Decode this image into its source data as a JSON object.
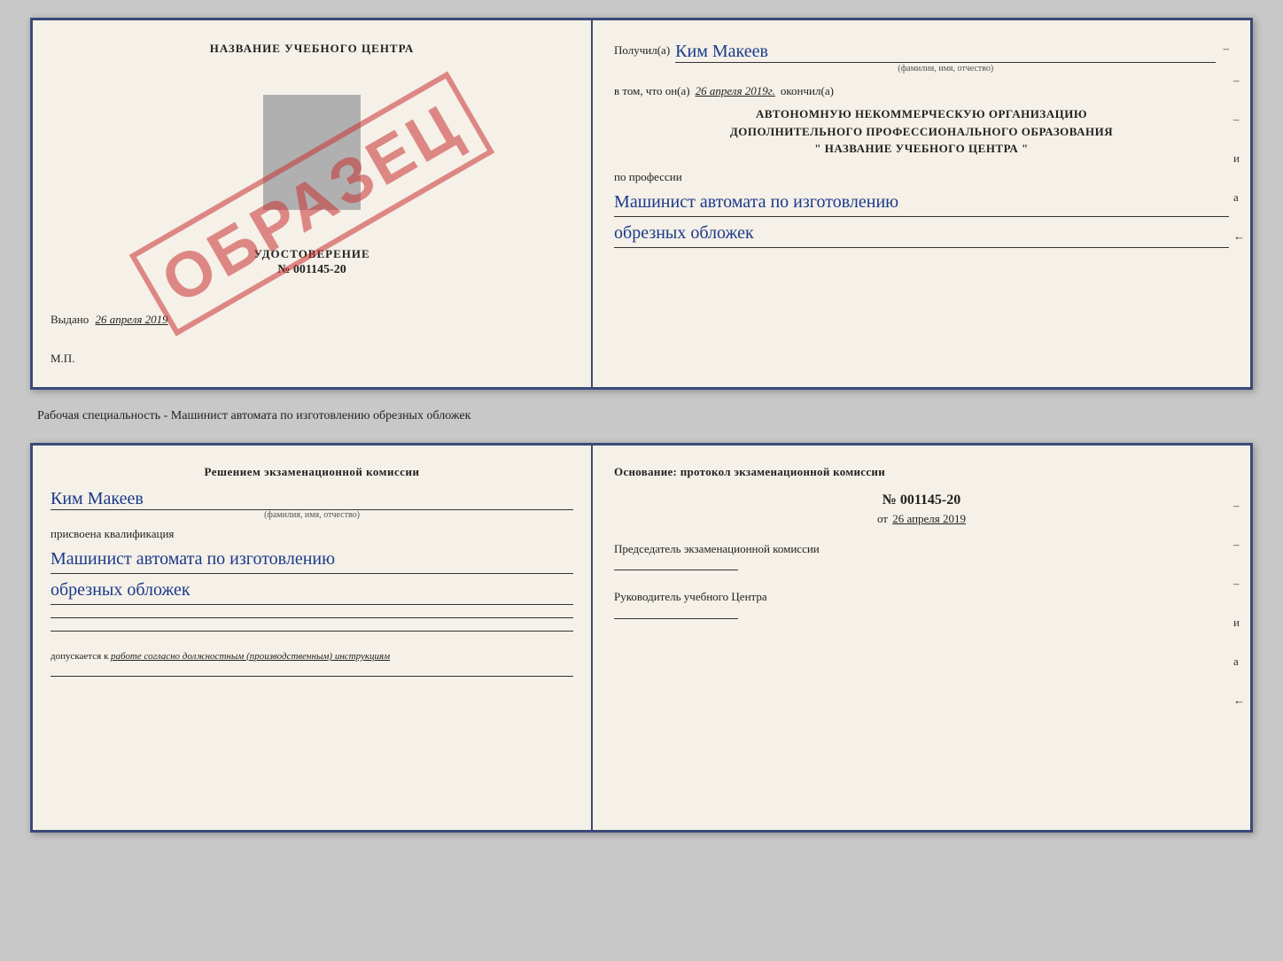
{
  "top_card": {
    "left": {
      "school_name": "НАЗВАНИЕ УЧЕБНОГО ЦЕНТРА",
      "udost_label": "УДОСТОВЕРЕНИЕ",
      "udost_number": "№ 001145-20",
      "vydano_label": "Выдано",
      "vydano_date": "26 апреля 2019",
      "mp_label": "М.П.",
      "obrazec": "ОБРАЗЕЦ"
    },
    "right": {
      "poluchil_label": "Получил(а)",
      "recipient_name": "Ким Макеев",
      "fio_hint": "(фамилия, имя, отчество)",
      "vtom_label": "в том, что он(а)",
      "vtom_date": "26 апреля 2019г.",
      "okonchil_label": "окончил(а)",
      "org_line1": "АВТОНОМНУЮ НЕКОММЕРЧЕСКУЮ ОРГАНИЗАЦИЮ",
      "org_line2": "ДОПОЛНИТЕЛЬНОГО ПРОФЕССИОНАЛЬНОГО ОБРАЗОВАНИЯ",
      "org_line3": "\" НАЗВАНИЕ УЧЕБНОГО ЦЕНТРА \"",
      "po_professii": "по профессии",
      "profession_line1": "Машинист автомата по изготовлению",
      "profession_line2": "обрезных обложек",
      "dash1": "–",
      "dash2": "–",
      "dash3": "–",
      "и_label": "и",
      "а_label": "а",
      "arrow_label": "←"
    }
  },
  "middle_text": "Рабочая специальность - Машинист автомата по изготовлению обрезных обложек",
  "bottom_card": {
    "left": {
      "resheniem_label": "Решением экзаменационной комиссии",
      "recipient_name": "Ким Макеев",
      "fio_hint": "(фамилия, имя, отчество)",
      "prisvoyena": "присвоена квалификация",
      "profession_line1": "Машинист автомата по изготовлению",
      "profession_line2": "обрезных обложек",
      "blank1": "",
      "blank2": "",
      "blank3": "",
      "dopuskaetsya_label": "допускается к",
      "dopuskaetsya_text": "работе согласно должностным (производственным) инструкциям",
      "blank4": ""
    },
    "right": {
      "osnovanie_label": "Основание: протокол экзаменационной комиссии",
      "number_label": "№  001145-20",
      "ot_label": "от",
      "ot_date": "26 апреля 2019",
      "predsedatel_label": "Председатель экзаменационной комиссии",
      "rukovoditel_label": "Руководитель учебного Центра",
      "dash1": "–",
      "dash2": "–",
      "dash3": "–",
      "и_label": "и",
      "а_label": "а",
      "arrow_label": "←"
    }
  }
}
